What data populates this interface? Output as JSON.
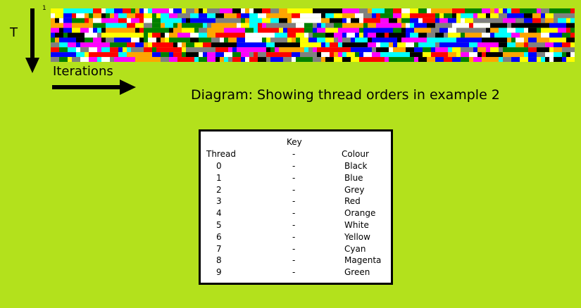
{
  "axis": {
    "down_label": "T",
    "corner_label": "1",
    "right_label": "Iterations"
  },
  "title": "Diagram: Showing thread orders in example 2",
  "key": {
    "heading": "Key",
    "header_thread": "Thread",
    "header_sep": "-",
    "header_colour": "Colour",
    "rows": [
      {
        "thread": "0",
        "sep": "-",
        "colour": "Black"
      },
      {
        "thread": "1",
        "sep": "-",
        "colour": "Blue"
      },
      {
        "thread": "2",
        "sep": "-",
        "colour": "Grey"
      },
      {
        "thread": "3",
        "sep": "-",
        "colour": "Red"
      },
      {
        "thread": "4",
        "sep": "-",
        "colour": "Orange"
      },
      {
        "thread": "5",
        "sep": "-",
        "colour": "White"
      },
      {
        "thread": "6",
        "sep": "-",
        "colour": "Yellow"
      },
      {
        "thread": "7",
        "sep": "-",
        "colour": "Cyan"
      },
      {
        "thread": "8",
        "sep": "-",
        "colour": "Magenta"
      },
      {
        "thread": "9",
        "sep": "-",
        "colour": "Green"
      }
    ]
  },
  "thread_colors": [
    "#000000",
    "#0000ff",
    "#808080",
    "#ff0000",
    "#ffa500",
    "#ffffff",
    "#ffff00",
    "#00ffff",
    "#ff00ff",
    "#008000"
  ]
}
